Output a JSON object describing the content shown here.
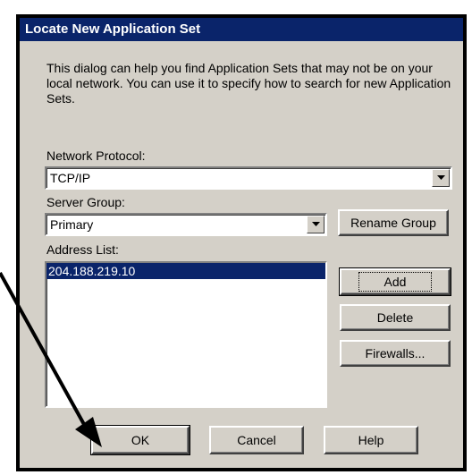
{
  "window": {
    "title": "Locate New Application Set"
  },
  "description": "This dialog can help you find Application Sets that may not be on your local network.  You can use it to specify how to search for new Application Sets.",
  "network_protocol": {
    "label": "Network Protocol:",
    "value": "TCP/IP"
  },
  "server_group": {
    "label": "Server Group:",
    "value": "Primary"
  },
  "address_list": {
    "label": "Address List:",
    "items": [
      "204.188.219.10"
    ],
    "selected_index": 0
  },
  "buttons": {
    "rename_group": "Rename Group",
    "add": "Add",
    "delete": "Delete",
    "firewalls": "Firewalls...",
    "ok": "OK",
    "cancel": "Cancel",
    "help": "Help"
  },
  "icons": {
    "dropdown": "chevron-down-icon",
    "annotation": "pointer-arrow-icon"
  },
  "colors": {
    "titlebar": "#0a246a",
    "face": "#d4d0c8",
    "selection": "#0a246a"
  }
}
